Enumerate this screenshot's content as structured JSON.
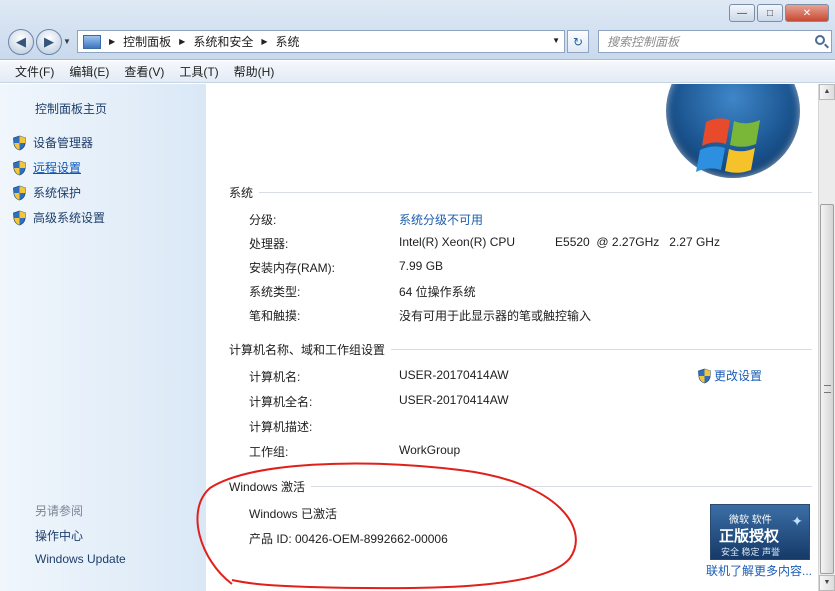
{
  "window": {
    "minimize": "—",
    "maximize": "□",
    "close": "✕"
  },
  "nav": {
    "back": "◀",
    "forward": "▶",
    "breadcrumbs": [
      "控制面板",
      "系统和安全",
      "系统"
    ],
    "search_placeholder": "搜索控制面板",
    "refresh": "↻"
  },
  "menu": [
    "文件(F)",
    "编辑(E)",
    "查看(V)",
    "工具(T)",
    "帮助(H)"
  ],
  "sidebar": {
    "home": "控制面板主页",
    "items": [
      {
        "label": "设备管理器",
        "icon": "uac-shield-icon"
      },
      {
        "label": "远程设置",
        "icon": "uac-shield-icon"
      },
      {
        "label": "系统保护",
        "icon": "uac-shield-icon"
      },
      {
        "label": "高级系统设置",
        "icon": "uac-shield-icon"
      }
    ],
    "see_also": "另请参阅",
    "links": [
      "操作中心",
      "Windows Update"
    ]
  },
  "system": {
    "heading": "系统",
    "rows": [
      {
        "key": "分级:",
        "value": "系统分级不可用",
        "link": true
      },
      {
        "key": "处理器:",
        "value": "Intel(R) Xeon(R) CPU",
        "value2": "E5520  @ 2.27GHz   2.27 GHz"
      },
      {
        "key": "安装内存(RAM):",
        "value": "7.99 GB"
      },
      {
        "key": "系统类型:",
        "value": "64 位操作系统"
      },
      {
        "key": "笔和触摸:",
        "value": "没有可用于此显示器的笔或触控输入"
      }
    ]
  },
  "computer": {
    "heading": "计算机名称、域和工作组设置",
    "change_settings": "更改设置",
    "rows": [
      {
        "key": "计算机名:",
        "value": "USER-20170414AW"
      },
      {
        "key": "计算机全名:",
        "value": "USER-20170414AW"
      },
      {
        "key": "计算机描述:",
        "value": ""
      },
      {
        "key": "工作组:",
        "value": "WorkGroup"
      }
    ]
  },
  "activation": {
    "heading": "Windows 激活",
    "status": "Windows 已激活",
    "product_id": "产品 ID: 00426-OEM-8992662-00006",
    "badge_top": "微软 软件",
    "badge_main": "正版授权",
    "badge_sub": "安全 稳定 声誉",
    "online_link": "联机了解更多内容..."
  },
  "colors": {
    "link": "#1a5db5",
    "annotation": "#e0201a"
  }
}
